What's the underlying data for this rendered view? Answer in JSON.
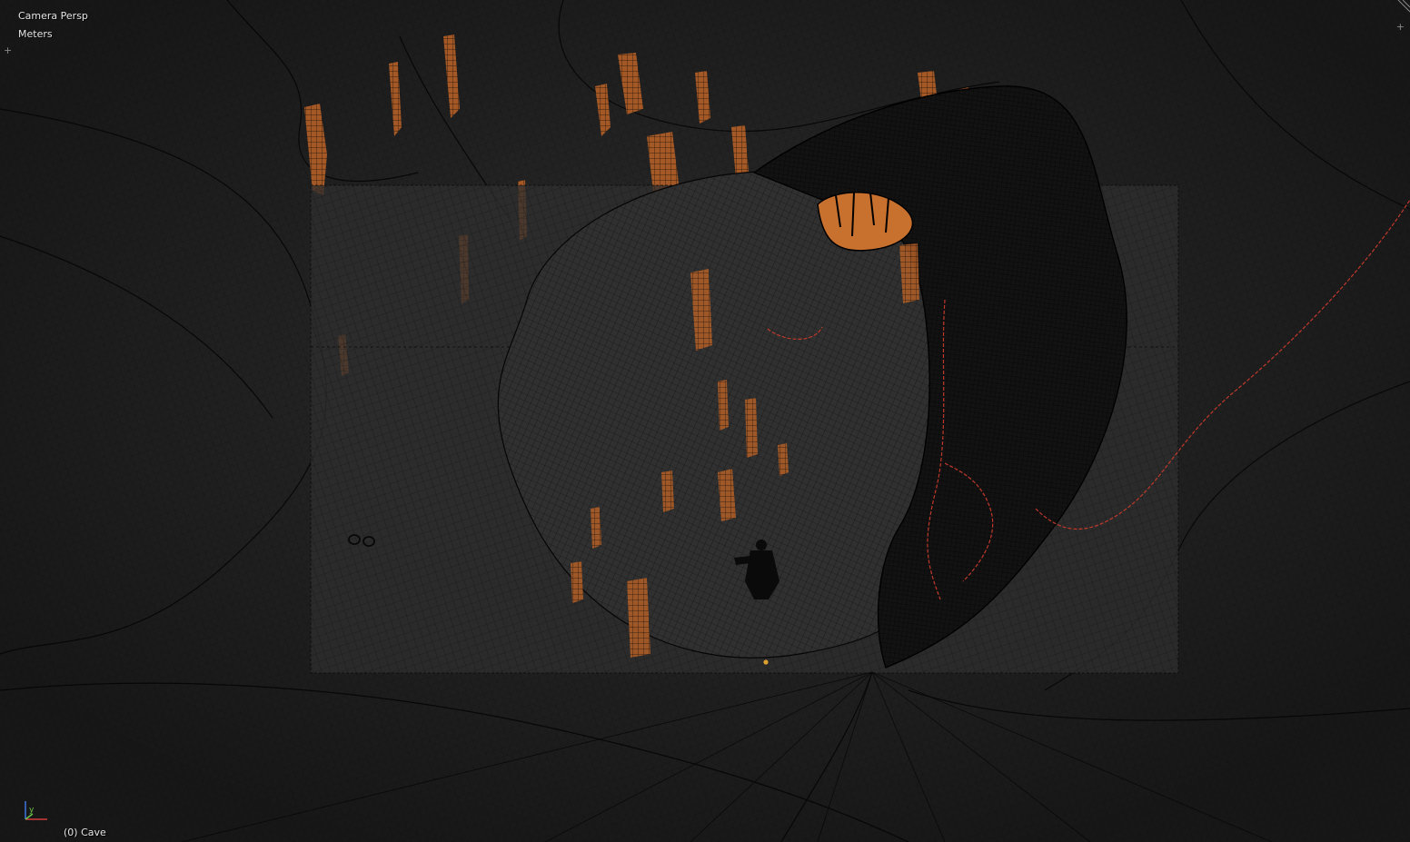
{
  "viewport": {
    "view_name": "Camera Persp",
    "units": "Meters",
    "object_info": "(0) Cave",
    "axis_labels": {
      "y": "y"
    },
    "icons": {
      "top_right_corner": "area-split-corner-icon",
      "axis_gizmo": "axis-orientation-icon"
    }
  },
  "colors": {
    "background": "#1f1f1f",
    "wire": "#000000",
    "camera_frame_fill": "#2e2e2e",
    "selection_orange": "#c86a2c",
    "edge_red": "#c0392b",
    "text": "#e6e6e6",
    "axis_x": "#d23c3c",
    "axis_y": "#6cc24a",
    "axis_z": "#3b6fd6"
  }
}
